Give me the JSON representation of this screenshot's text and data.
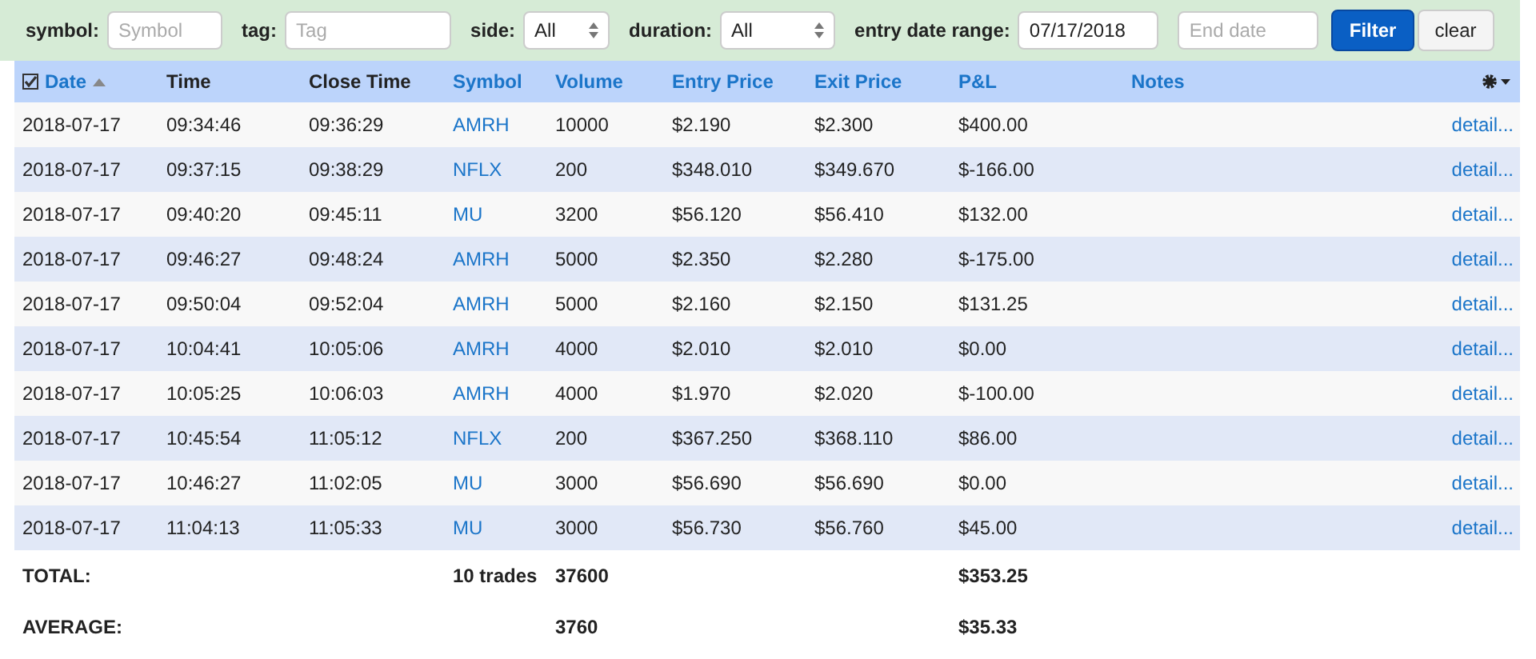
{
  "filters": [
    {
      "kind": "text",
      "label": "symbol:",
      "placeholder": "Symbol"
    },
    {
      "kind": "text",
      "label": "tag:",
      "placeholder": "Tag"
    },
    {
      "kind": "select",
      "label": "side:",
      "value": "All"
    },
    {
      "kind": "select",
      "label": "duration:",
      "value": "All"
    },
    {
      "kind": "text",
      "label": "entry date range:",
      "value": "07/17/2018"
    },
    {
      "kind": "text",
      "placeholder": "End date"
    }
  ],
  "buttons": [
    {
      "label": "Filter",
      "primary": true
    },
    {
      "label": "clear",
      "primary": false
    }
  ],
  "table": {
    "select_all_checked": true,
    "columns": [
      {
        "label": "Date",
        "sortable": true,
        "sorted_ascending": true
      },
      {
        "label": "Time",
        "sortable": false
      },
      {
        "label": "Close Time",
        "sortable": false
      },
      {
        "label": "Symbol",
        "sortable": true
      },
      {
        "label": "Volume",
        "sortable": true
      },
      {
        "label": "Entry Price",
        "sortable": true
      },
      {
        "label": "Exit Price",
        "sortable": true
      },
      {
        "label": "P&L",
        "sortable": true
      },
      {
        "label": "Notes",
        "sortable": true
      }
    ],
    "rows": [
      [
        "2018-07-17",
        "09:34:46",
        "09:36:29",
        "AMRH",
        "10000",
        "$2.190",
        "$2.300",
        "$400.00",
        "detail..."
      ],
      [
        "2018-07-17",
        "09:37:15",
        "09:38:29",
        "NFLX",
        "200",
        "$348.010",
        "$349.670",
        "$-166.00",
        "detail..."
      ],
      [
        "2018-07-17",
        "09:40:20",
        "09:45:11",
        "MU",
        "3200",
        "$56.120",
        "$56.410",
        "$132.00",
        "detail..."
      ],
      [
        "2018-07-17",
        "09:46:27",
        "09:48:24",
        "AMRH",
        "5000",
        "$2.350",
        "$2.280",
        "$-175.00",
        "detail..."
      ],
      [
        "2018-07-17",
        "09:50:04",
        "09:52:04",
        "AMRH",
        "5000",
        "$2.160",
        "$2.150",
        "$131.25",
        "detail..."
      ],
      [
        "2018-07-17",
        "10:04:41",
        "10:05:06",
        "AMRH",
        "4000",
        "$2.010",
        "$2.010",
        "$0.00",
        "detail..."
      ],
      [
        "2018-07-17",
        "10:05:25",
        "10:06:03",
        "AMRH",
        "4000",
        "$1.970",
        "$2.020",
        "$-100.00",
        "detail..."
      ],
      [
        "2018-07-17",
        "10:45:54",
        "11:05:12",
        "NFLX",
        "200",
        "$367.250",
        "$368.110",
        "$86.00",
        "detail..."
      ],
      [
        "2018-07-17",
        "10:46:27",
        "11:02:05",
        "MU",
        "3000",
        "$56.690",
        "$56.690",
        "$0.00",
        "detail..."
      ],
      [
        "2018-07-17",
        "11:04:13",
        "11:05:33",
        "MU",
        "3000",
        "$56.730",
        "$56.760",
        "$45.00",
        "detail..."
      ]
    ],
    "footer": [
      {
        "label": "TOTAL:",
        "trades": "10 trades",
        "volume": "37600",
        "pnl": "$353.25"
      },
      {
        "label": "AVERAGE:",
        "volume": "3760",
        "pnl": "$35.33"
      }
    ]
  }
}
